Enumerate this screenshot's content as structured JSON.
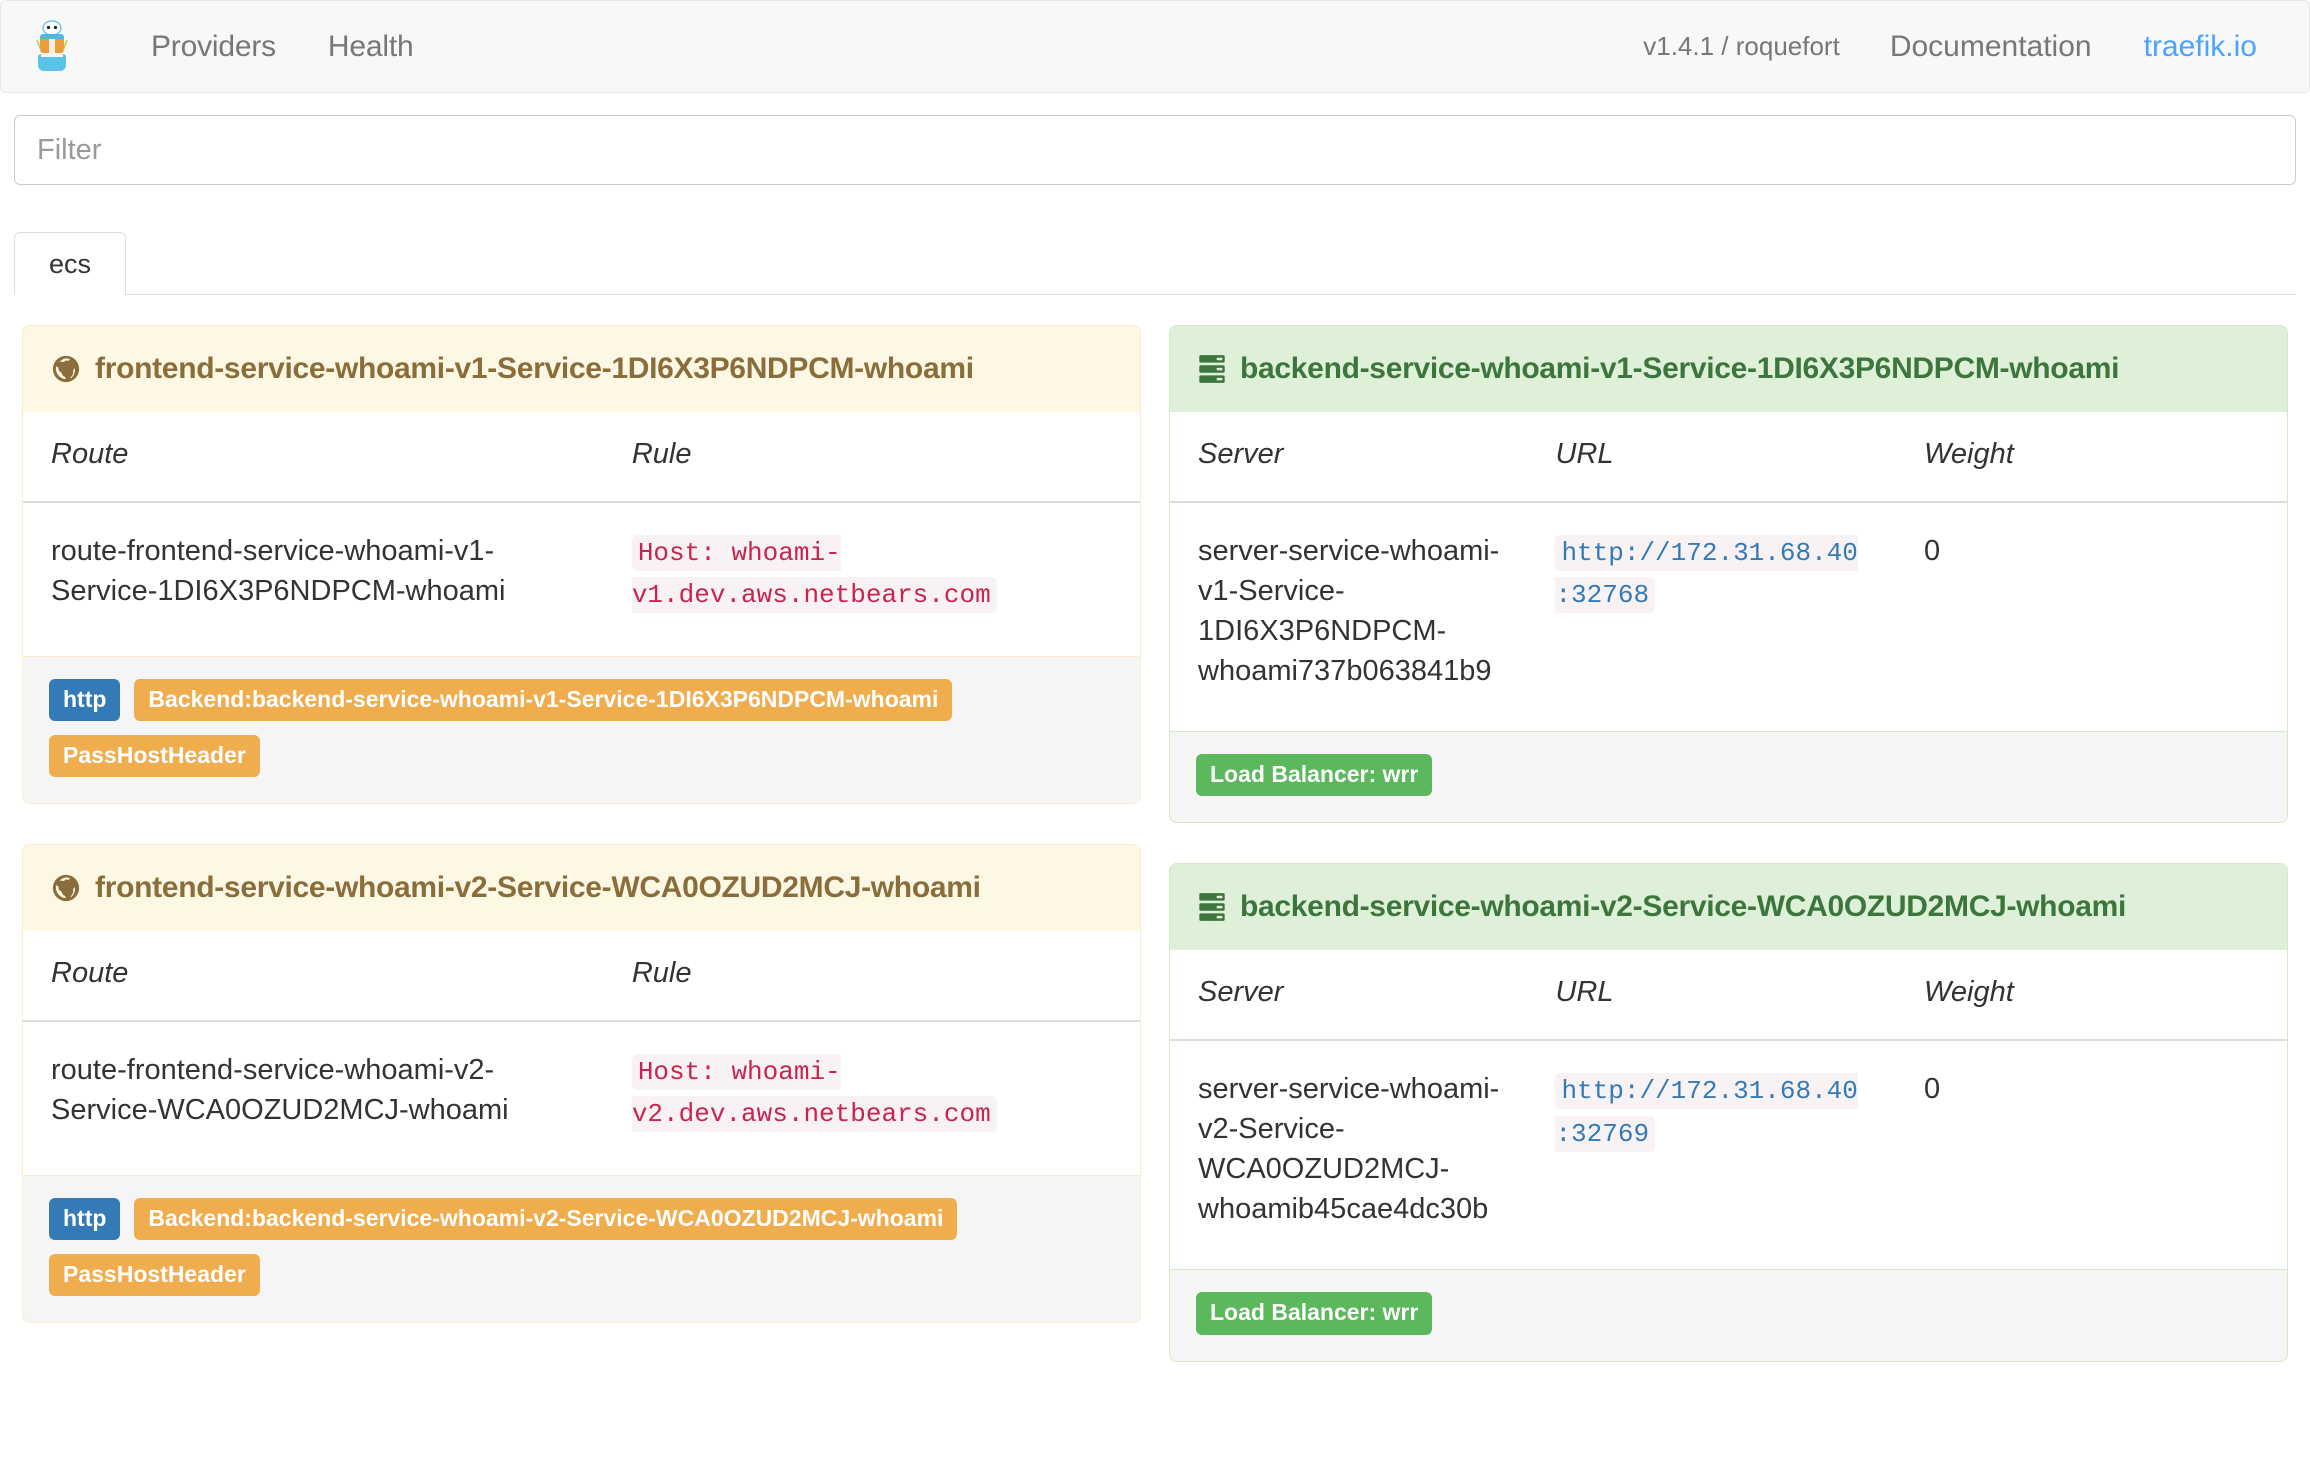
{
  "navbar": {
    "brand_icon": "traefik-gopher-logo",
    "links": [
      {
        "label": "Providers",
        "name": "nav-link-providers"
      },
      {
        "label": "Health",
        "name": "nav-link-health"
      }
    ],
    "version": "v1.4.1 / roquefort",
    "documentation": "Documentation",
    "site": "traefik.io"
  },
  "filter": {
    "placeholder": "Filter",
    "value": ""
  },
  "tabs": [
    {
      "label": "ecs",
      "active": true
    }
  ],
  "frontends": [
    {
      "icon": "globe-icon",
      "title": "frontend-service-whoami-v1-Service-1DI6X3P6NDPCM-whoami",
      "columns": {
        "route": "Route",
        "rule": "Rule"
      },
      "rows": [
        {
          "route": "route-frontend-service-whoami-v1-Service-1DI6X3P6NDPCM-whoami",
          "rule": "Host: whoami-v1.dev.aws.netbears.com"
        }
      ],
      "badges": [
        {
          "text": "http",
          "style": "primary"
        },
        {
          "text": "Backend:backend-service-whoami-v1-Service-1DI6X3P6NDPCM-whoami",
          "style": "warning"
        },
        {
          "text": "PassHostHeader",
          "style": "warning"
        }
      ]
    },
    {
      "icon": "globe-icon",
      "title": "frontend-service-whoami-v2-Service-WCA0OZUD2MCJ-whoami",
      "columns": {
        "route": "Route",
        "rule": "Rule"
      },
      "rows": [
        {
          "route": "route-frontend-service-whoami-v2-Service-WCA0OZUD2MCJ-whoami",
          "rule": "Host: whoami-v2.dev.aws.netbears.com"
        }
      ],
      "badges": [
        {
          "text": "http",
          "style": "primary"
        },
        {
          "text": "Backend:backend-service-whoami-v2-Service-WCA0OZUD2MCJ-whoami",
          "style": "warning"
        },
        {
          "text": "PassHostHeader",
          "style": "warning"
        }
      ]
    }
  ],
  "backends": [
    {
      "icon": "server-icon",
      "title": "backend-service-whoami-v1-Service-1DI6X3P6NDPCM-whoami",
      "columns": {
        "server": "Server",
        "url": "URL",
        "weight": "Weight"
      },
      "rows": [
        {
          "server": "server-service-whoami-v1-Service-1DI6X3P6NDPCM-whoami737b063841b9",
          "url": "http://172.31.68.40:32768",
          "weight": "0"
        }
      ],
      "badges": [
        {
          "text": "Load Balancer: wrr",
          "style": "success"
        }
      ]
    },
    {
      "icon": "server-icon",
      "title": "backend-service-whoami-v2-Service-WCA0OZUD2MCJ-whoami",
      "columns": {
        "server": "Server",
        "url": "URL",
        "weight": "Weight"
      },
      "rows": [
        {
          "server": "server-service-whoami-v2-Service-WCA0OZUD2MCJ-whoamib45cae4dc30b",
          "url": "http://172.31.68.40:32769",
          "weight": "0"
        }
      ],
      "badges": [
        {
          "text": "Load Balancer: wrr",
          "style": "success"
        }
      ]
    }
  ],
  "colors": {
    "warning_bg": "#fcf8e3",
    "warning_border": "#faebcc",
    "warning_text": "#8a6d3b",
    "success_bg": "#dff0d8",
    "success_border": "#d6e9c6",
    "success_text": "#3c763d",
    "label_primary": "#337ab7",
    "label_warning": "#f0ad4e",
    "label_success": "#5cb85c",
    "link": "#4aa3ff",
    "code_rule": "#c7254e",
    "code_url": "#337ab7"
  }
}
